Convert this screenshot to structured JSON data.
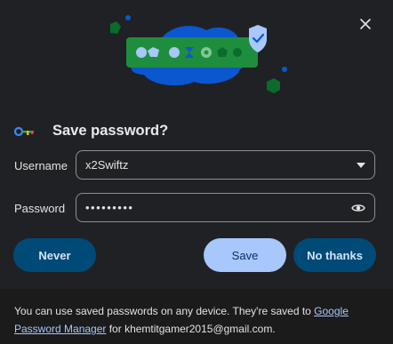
{
  "dialog": {
    "title": "Save password?",
    "close_icon": "close-icon"
  },
  "form": {
    "username_label": "Username",
    "username_value": "x2Swiftz",
    "password_label": "Password",
    "password_value": "•••••••••"
  },
  "buttons": {
    "never": "Never",
    "save": "Save",
    "no_thanks": "No thanks"
  },
  "footer": {
    "text_before": "You can use saved passwords on any device. They're saved to ",
    "link_text": "Google Password Manager",
    "text_after": " for khemtitgamer2015@gmail.com."
  },
  "colors": {
    "background": "#202124",
    "footer_background": "#1b1b1c",
    "primary_button": "#a8c7fa",
    "secondary_button": "#004a77",
    "link": "#a8c7fa",
    "illustration_blue": "#0b57d0",
    "illustration_green": "#1e8e3e"
  }
}
